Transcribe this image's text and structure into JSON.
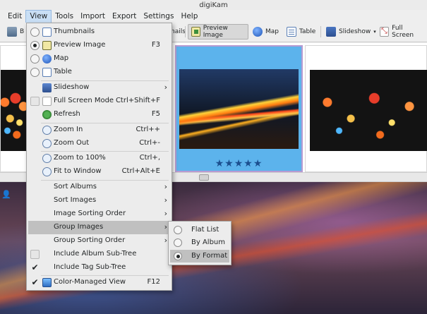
{
  "window": {
    "title": "digiKam"
  },
  "menubar": [
    "Edit",
    "View",
    "Tools",
    "Import",
    "Export",
    "Settings",
    "Help"
  ],
  "toolbar": {
    "albums_label": "B",
    "thumbnails_partial": "nails",
    "preview_image": "Preview Image",
    "map": "Map",
    "table": "Table",
    "slideshow": "Slideshow",
    "full_screen": "Full Screen"
  },
  "thumbnails": {
    "rating_stars": "★★★★★",
    "rating": 5
  },
  "view_menu": {
    "items": [
      {
        "label": "Thumbnails",
        "shortcut": ""
      },
      {
        "label": "Preview Image",
        "shortcut": "F3"
      },
      {
        "label": "Map",
        "shortcut": ""
      },
      {
        "label": "Table",
        "shortcut": ""
      },
      {
        "label": "Slideshow",
        "shortcut": ""
      },
      {
        "label": "Full Screen Mode",
        "shortcut": "Ctrl+Shift+F"
      },
      {
        "label": "Refresh",
        "shortcut": "F5"
      },
      {
        "label": "Zoom In",
        "shortcut": "Ctrl++"
      },
      {
        "label": "Zoom Out",
        "shortcut": "Ctrl+-"
      },
      {
        "label": "Zoom to 100%",
        "shortcut": "Ctrl+,"
      },
      {
        "label": "Fit to Window",
        "shortcut": "Ctrl+Alt+E"
      },
      {
        "label": "Sort Albums",
        "shortcut": ""
      },
      {
        "label": "Sort Images",
        "shortcut": ""
      },
      {
        "label": "Image Sorting Order",
        "shortcut": ""
      },
      {
        "label": "Group Images",
        "shortcut": ""
      },
      {
        "label": "Group Sorting Order",
        "shortcut": ""
      },
      {
        "label": "Include Album Sub-Tree",
        "shortcut": ""
      },
      {
        "label": "Include Tag Sub-Tree",
        "shortcut": ""
      },
      {
        "label": "Color-Managed View",
        "shortcut": "F12"
      }
    ]
  },
  "group_images_submenu": {
    "items": [
      {
        "label": "Flat List"
      },
      {
        "label": "By Album"
      },
      {
        "label": "By Format"
      }
    ]
  }
}
